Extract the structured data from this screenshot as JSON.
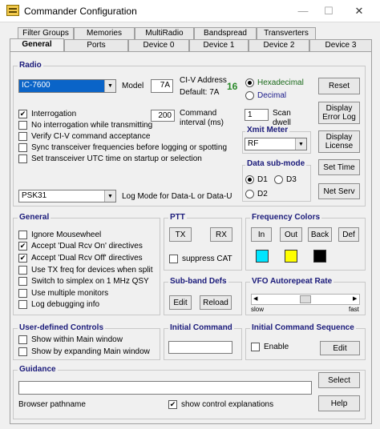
{
  "window": {
    "title": "Commander Configuration",
    "minimize": "—",
    "maximize": "☐",
    "close": "✕"
  },
  "tabs_row1": [
    "Filter Groups",
    "Memories",
    "MultiRadio",
    "Bandspread",
    "Transverters"
  ],
  "tabs_row2": [
    "General",
    "Ports",
    "Device 0",
    "Device 1",
    "Device 2",
    "Device 3"
  ],
  "radio": {
    "group_title": "Radio",
    "model_select": "IC-7600",
    "model_label": "Model",
    "model_value": "7A",
    "civ_label": "CI-V Address",
    "civ_default": "Default: 7A",
    "civ_value": "16",
    "hex_label": "Hexadecimal",
    "dec_label": "Decimal",
    "reset": "Reset",
    "interrogation": "Interrogation",
    "no_interrogation": "No interrogation while transmitting",
    "verify_civ": "Verify CI-V command acceptance",
    "sync_freq": "Sync transceiver frequencies before logging or spotting",
    "set_utc": "Set transceiver UTC time on startup or selection",
    "cmd_interval_value": "200",
    "cmd_interval_label": "Command interval (ms)",
    "scan_value": "1",
    "scan_label": "Scan dwell",
    "display_error_log": "Display Error Log",
    "display_license": "Display License",
    "xmit_meter_title": "Xmit Meter",
    "xmit_meter_value": "RF",
    "data_submode_title": "Data sub-mode",
    "d1": "D1",
    "d2": "D2",
    "d3": "D3",
    "set_time": "Set Time",
    "net_serv": "Net Serv",
    "log_mode_value": "PSK31",
    "log_mode_label": "Log Mode for Data-L or Data-U"
  },
  "general": {
    "group_title": "General",
    "ignore_mousewheel": "Ignore Mousewheel",
    "dual_rcv_on": "Accept 'Dual Rcv On' directives",
    "dual_rcv_off": "Accept 'Dual Rcv Off' directives",
    "use_tx_freq": "Use TX freq for devices when split",
    "switch_simplex": "Switch to simplex on 1 MHz QSY",
    "use_multiple": "Use multiple monitors",
    "log_debug": "Log debugging info"
  },
  "ptt": {
    "group_title": "PTT",
    "tx": "TX",
    "rx": "RX",
    "suppress_cat": "suppress CAT"
  },
  "subband": {
    "group_title": "Sub-band Defs",
    "edit": "Edit",
    "reload": "Reload"
  },
  "freq_colors": {
    "group_title": "Frequency Colors",
    "in": "In",
    "out": "Out",
    "back": "Back",
    "def": "Def",
    "colors": [
      "#00e5ff",
      "#ffff00",
      "#000000"
    ]
  },
  "vfo": {
    "group_title": "VFO Autorepeat Rate",
    "slow": "slow",
    "fast": "fast"
  },
  "user_controls": {
    "group_title": "User-defined Controls",
    "show_within": "Show within Main window",
    "show_expanding": "Show by expanding Main window"
  },
  "initial_command": {
    "group_title": "Initial Command",
    "value": ""
  },
  "initial_sequence": {
    "group_title": "Initial Command Sequence",
    "enable": "Enable",
    "edit": "Edit"
  },
  "guidance": {
    "group_title": "Guidance",
    "browser_value": "",
    "select": "Select",
    "browser_label": "Browser pathname",
    "show_explanations": "show control explanations",
    "help": "Help"
  }
}
